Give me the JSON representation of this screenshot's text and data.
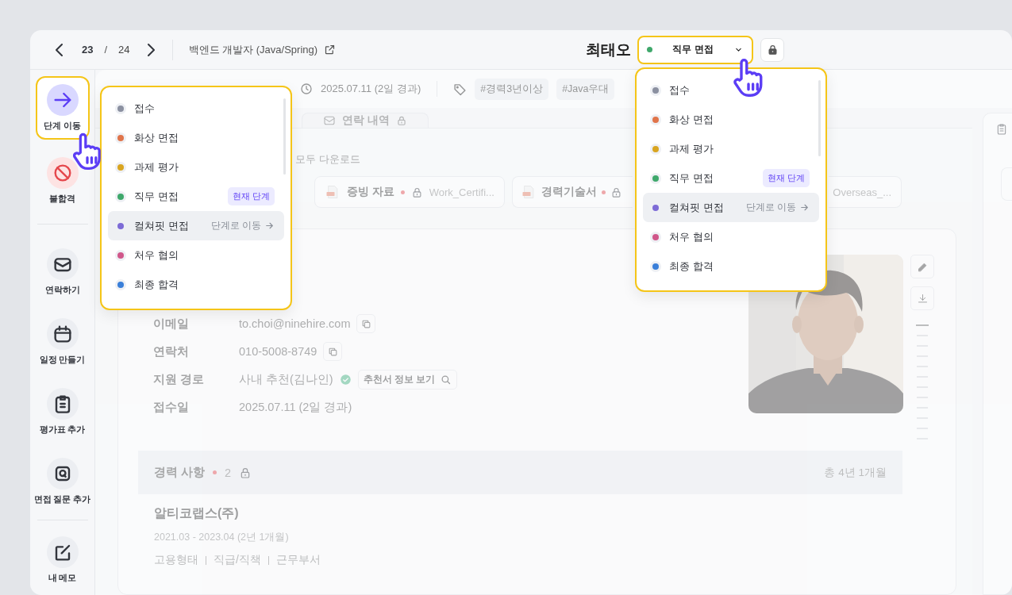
{
  "pager": {
    "current": "23",
    "separator": "/",
    "total": "24"
  },
  "job_title": "백엔드 개발자 (Java/Spring)",
  "candidate": {
    "name": "최태오",
    "stage": {
      "label": "직무 면접",
      "color": "#3fa86b"
    }
  },
  "action_groups": [
    [
      {
        "kind": "move",
        "label": "단계 이동",
        "highlighted": true
      },
      {
        "kind": "reject",
        "label": "불합격",
        "highlighted": false
      }
    ],
    [
      {
        "kind": "contact",
        "label": "연락하기",
        "highlighted": false
      },
      {
        "kind": "schedule",
        "label": "일정 만들기",
        "highlighted": false
      },
      {
        "kind": "evaluation",
        "label": "평가표 추가",
        "highlighted": false
      },
      {
        "kind": "question",
        "label": "면접 질문 추가",
        "highlighted": false
      }
    ],
    [
      {
        "kind": "memo",
        "label": "내 메모",
        "highlighted": false
      }
    ]
  ],
  "info_bar": {
    "date": "2025.07.11 (2일 경과)",
    "tags": [
      "#경력3년이상",
      "#Java우대"
    ]
  },
  "tabs": [
    {
      "label": "연락 내역",
      "locked": true,
      "selected": false
    }
  ],
  "attachments": {
    "download_all": "모두 다운로드",
    "files": [
      {
        "title": "증빙 자료",
        "file": "Work_Certifi..."
      },
      {
        "title": "경력기술서"
      },
      {
        "file": "Overseas_..."
      }
    ]
  },
  "profile": {
    "fields": [
      {
        "kind": "copy",
        "label": "이메일",
        "value": "to.choi@ninehire.com"
      },
      {
        "kind": "copy",
        "label": "연락처",
        "value": "010-5008-8749"
      },
      {
        "kind": "referral",
        "label": "지원 경로",
        "value": "사내 추천(김나인)",
        "verified": true,
        "action": "추천서 정보 보기"
      },
      {
        "kind": "plain",
        "label": "접수일",
        "value": "2025.07.11 (2일 경과)"
      }
    ]
  },
  "career": {
    "title": "경력 사항",
    "count": "2",
    "locked": true,
    "total": "총 4년 1개월",
    "entries": [
      {
        "company": "알티코랩스(주)",
        "period": "2021.03 - 2023.04 (2년 1개월)",
        "details": [
          "고용형태",
          "직급/직책",
          "근무부서"
        ]
      }
    ]
  },
  "stage_menus": [
    {
      "current_label": "현재 단계",
      "hover_label": "단계로 이동",
      "items": [
        {
          "label": "접수",
          "color": "#8b90a0",
          "current": false,
          "hovered": false
        },
        {
          "label": "화상 면접",
          "color": "#e0744a",
          "current": false,
          "hovered": false
        },
        {
          "label": "과제 평가",
          "color": "#d9a520",
          "current": false,
          "hovered": false
        },
        {
          "label": "직무 면접",
          "color": "#3fa86b",
          "current": true,
          "hovered": false
        },
        {
          "label": "컬쳐핏 면접",
          "color": "#7d6bd6",
          "current": false,
          "hovered": true
        },
        {
          "label": "처우 협의",
          "color": "#d0578a",
          "current": false,
          "hovered": false
        },
        {
          "label": "최종 합격",
          "color": "#3a7fd9",
          "current": false,
          "hovered": false
        }
      ]
    },
    {
      "current_label": "현재 단계",
      "hover_label": "단계로 이동",
      "items": [
        {
          "label": "접수",
          "color": "#8b90a0",
          "current": false,
          "hovered": false
        },
        {
          "label": "화상 면접",
          "color": "#e0744a",
          "current": false,
          "hovered": false
        },
        {
          "label": "과제 평가",
          "color": "#d9a520",
          "current": false,
          "hovered": false
        },
        {
          "label": "직무 면접",
          "color": "#3fa86b",
          "current": true,
          "hovered": false
        },
        {
          "label": "컬쳐핏 면접",
          "color": "#7d6bd6",
          "current": false,
          "hovered": true
        },
        {
          "label": "처우 협의",
          "color": "#d0578a",
          "current": false,
          "hovered": false
        },
        {
          "label": "최종 합격",
          "color": "#3a7fd9",
          "current": false,
          "hovered": false
        }
      ]
    }
  ]
}
